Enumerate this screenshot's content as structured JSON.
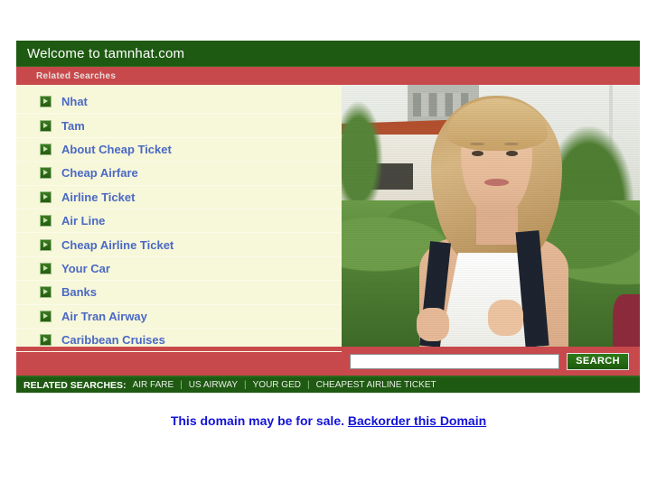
{
  "header": {
    "title": "Welcome to tamnhat.com",
    "related_searches_label": "Related Searches"
  },
  "links": [
    {
      "label": "Nhat"
    },
    {
      "label": "Tam"
    },
    {
      "label": "About Cheap Ticket"
    },
    {
      "label": "Cheap Airfare"
    },
    {
      "label": "Airline Ticket"
    },
    {
      "label": "Air Line"
    },
    {
      "label": "Cheap Airline Ticket"
    },
    {
      "label": "Your Car"
    },
    {
      "label": "Banks"
    },
    {
      "label": "Air Tran Airway"
    },
    {
      "label": "Caribbean Cruises"
    }
  ],
  "search": {
    "value": "",
    "placeholder": "",
    "button_label": "SEARCH"
  },
  "footer": {
    "label": "RELATED SEARCHES:",
    "separator": "|",
    "terms": [
      "AIR FARE",
      "US AIRWAY",
      "YOUR GED",
      "CHEAPEST AIRLINE TICKET"
    ]
  },
  "for_sale": {
    "text": "This domain may be for sale.",
    "link_text": "Backorder this Domain"
  },
  "photo": {
    "alt": "Smiling blonde young woman wearing a backpack outdoors in front of a building and hedges"
  },
  "colors": {
    "green_dark": "#1e5a12",
    "red": "#c8494b",
    "cream": "#f7f7da",
    "link_blue": "#4a69c4",
    "sale_blue": "#1313d8"
  }
}
